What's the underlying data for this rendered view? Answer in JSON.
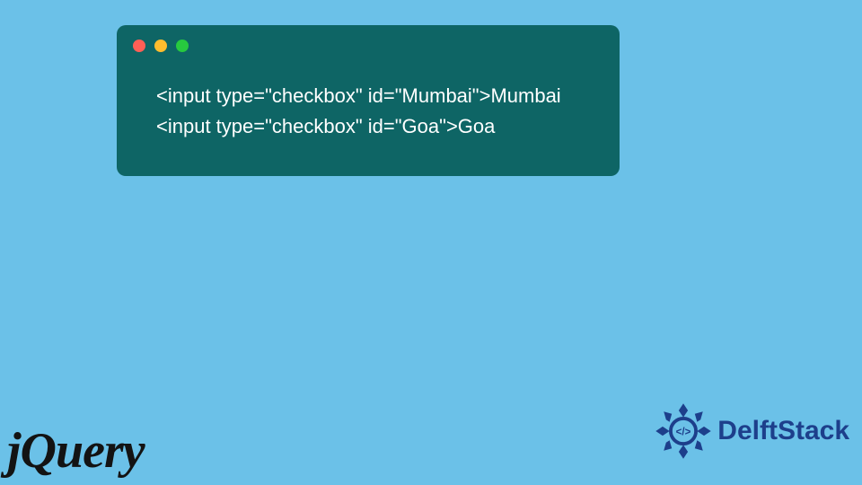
{
  "code": {
    "lines": [
      "<input type=\"checkbox\" id=\"Mumbai\">Mumbai",
      "<input type=\"checkbox\" id=\"Goa\">Goa"
    ]
  },
  "logos": {
    "jquery": "jQuery",
    "delftstack": "DelftStack"
  },
  "colors": {
    "page_bg": "#6bc1e8",
    "code_bg": "#0e6565",
    "code_fg": "#ffffff",
    "logo_fg": "#131313",
    "delft_fg": "#1d3f8b",
    "dot_red": "#ff5f56",
    "dot_yellow": "#ffbd2e",
    "dot_green": "#27c93f"
  }
}
